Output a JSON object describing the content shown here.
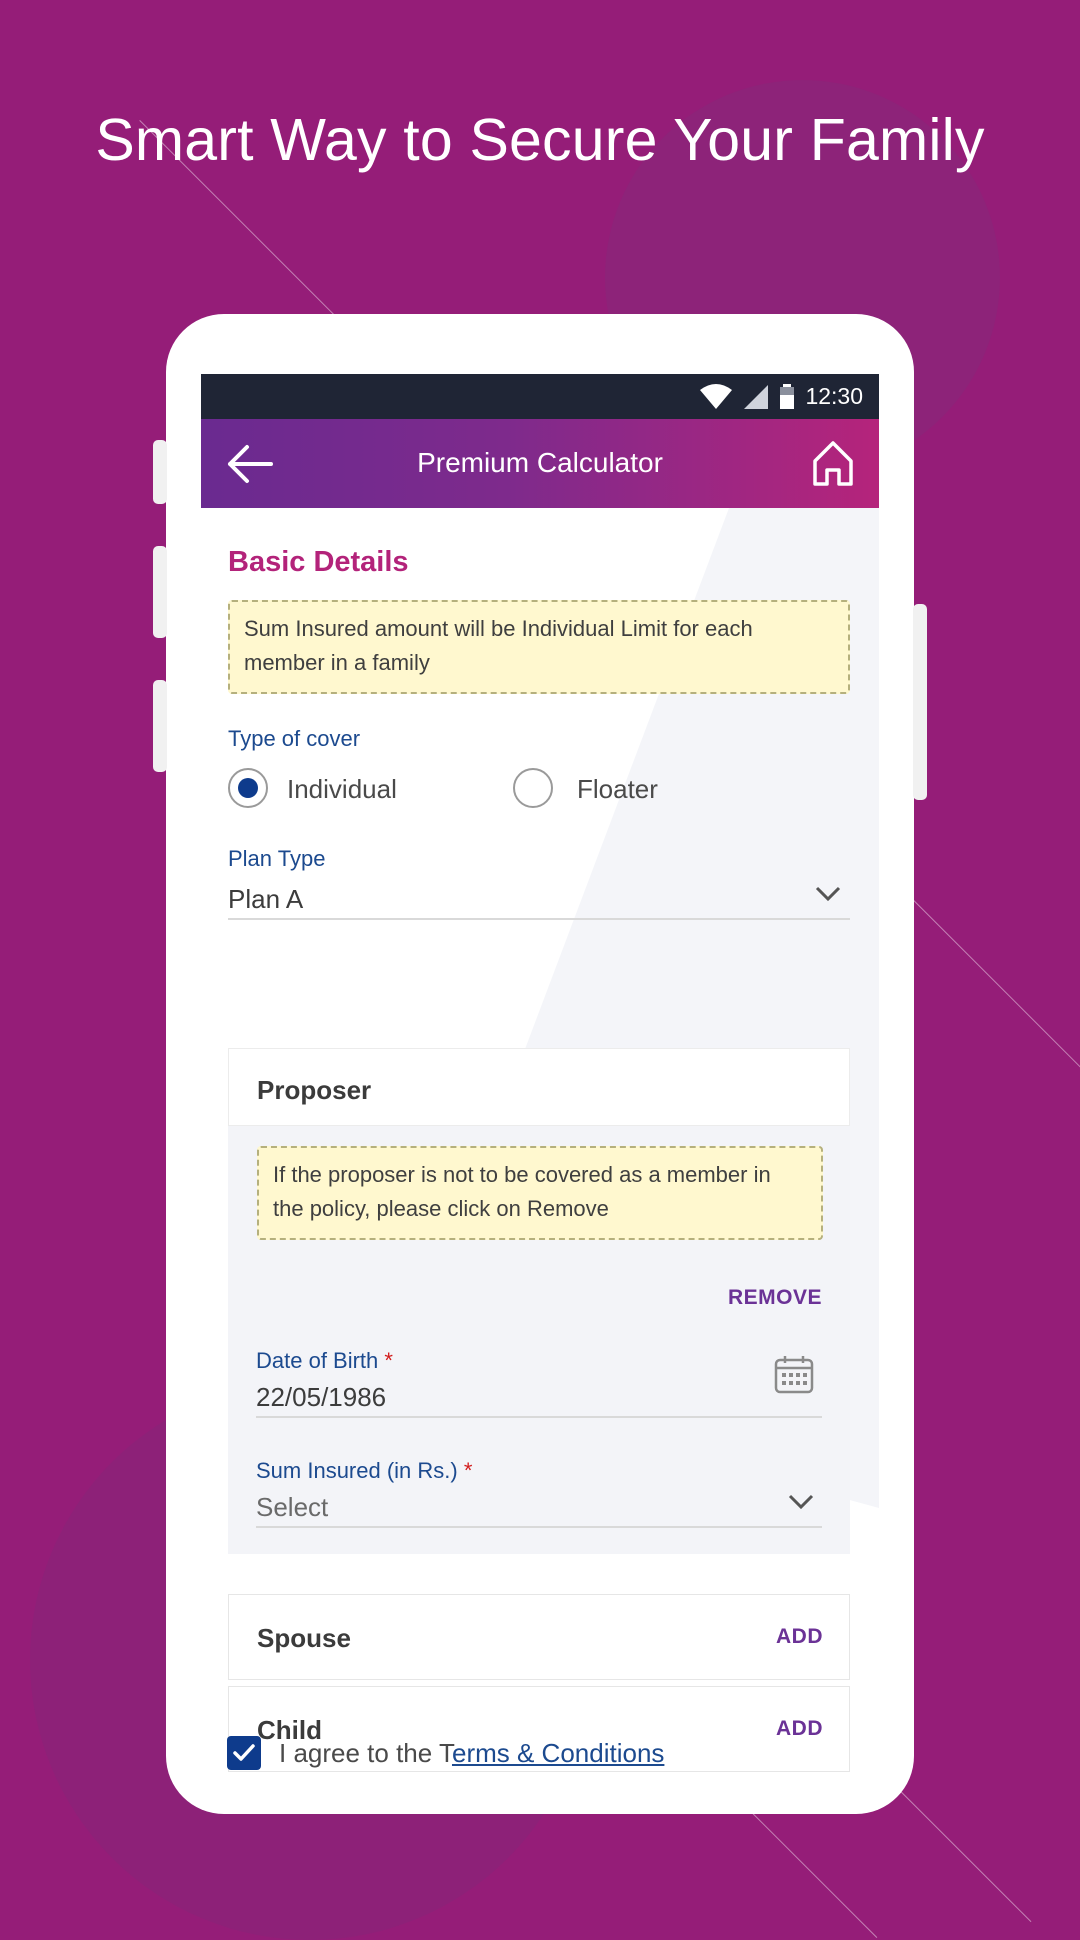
{
  "headline": "Smart Way to Secure Your Family",
  "status_bar": {
    "time": "12:30",
    "icons": [
      "wifi-icon",
      "signal-icon",
      "battery-icon"
    ]
  },
  "app_bar": {
    "title": "Premium Calculator",
    "back_icon": "arrow-left-icon",
    "home_icon": "home-icon"
  },
  "basic_details": {
    "section_title": "Basic Details",
    "info_note": "Sum Insured amount will be Individual Limit for each member in a family",
    "type_of_cover": {
      "label": "Type of cover",
      "options": [
        {
          "label": "Individual",
          "selected": true
        },
        {
          "label": "Floater",
          "selected": false
        }
      ]
    },
    "plan_type": {
      "label": "Plan Type",
      "value": "Plan A"
    }
  },
  "proposer": {
    "title": "Proposer",
    "note": "If the proposer is not to be covered as a member in the policy, please click on Remove",
    "remove_label": "REMOVE",
    "dob": {
      "label": "Date of Birth",
      "required_mark": "*",
      "value": "22/05/1986"
    },
    "sum_insured": {
      "label": "Sum Insured (in Rs.)",
      "required_mark": "*",
      "placeholder": "Select"
    }
  },
  "members": [
    {
      "name": "Spouse",
      "action": "ADD"
    },
    {
      "name": "Child",
      "action": "ADD"
    }
  ],
  "agreement": {
    "checked": true,
    "text_prefix": "I agree to the T",
    "link_text": "erms & Conditions"
  },
  "colors": {
    "background": "#951d78",
    "brand_magenta": "#b3237a",
    "brand_blue": "#0e3b8c",
    "note_bg": "#fff8cf"
  }
}
